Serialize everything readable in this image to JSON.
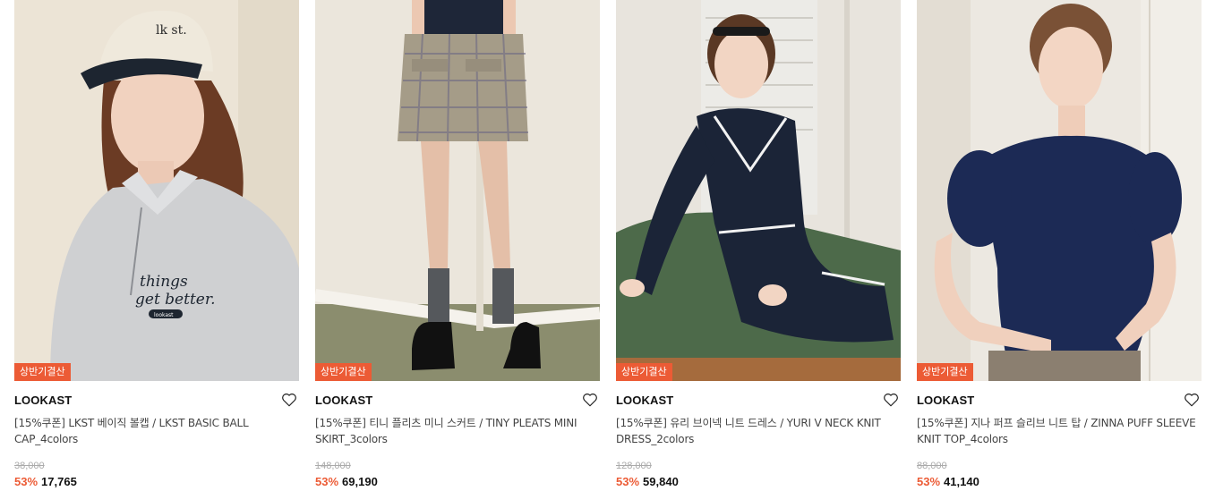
{
  "products": [
    {
      "badge": "상반기결산",
      "brand": "LOOKAST",
      "name": "[15%쿠폰] LKST 베이직 볼캡 / LKST BASIC BALL CAP_4colors",
      "original_price": "38,000",
      "discount": "53%",
      "price": "17,765",
      "cap_text": "lk st.",
      "shirt_text_1": "things",
      "shirt_text_2": "get better.",
      "shirt_patch": "lookast"
    },
    {
      "badge": "상반기결산",
      "brand": "LOOKAST",
      "name": "[15%쿠폰] 티니 플리츠 미니 스커트 / TINY PLEATS MINI SKIRT_3colors",
      "original_price": "148,000",
      "discount": "53%",
      "price": "69,190"
    },
    {
      "badge": "상반기결산",
      "brand": "LOOKAST",
      "name": "[15%쿠폰] 유리 브이넥 니트 드레스 / YURI V NECK KNIT DRESS_2colors",
      "original_price": "128,000",
      "discount": "53%",
      "price": "59,840"
    },
    {
      "badge": "상반기결산",
      "brand": "LOOKAST",
      "name": "[15%쿠폰] 지나 퍼프 슬리브 니트 탑 / ZINNA PUFF SLEEVE KNIT TOP_4colors",
      "original_price": "88,000",
      "discount": "53%",
      "price": "41,140"
    }
  ],
  "colors": {
    "accent": "#ec5b35",
    "strike": "#aaaaaa"
  }
}
